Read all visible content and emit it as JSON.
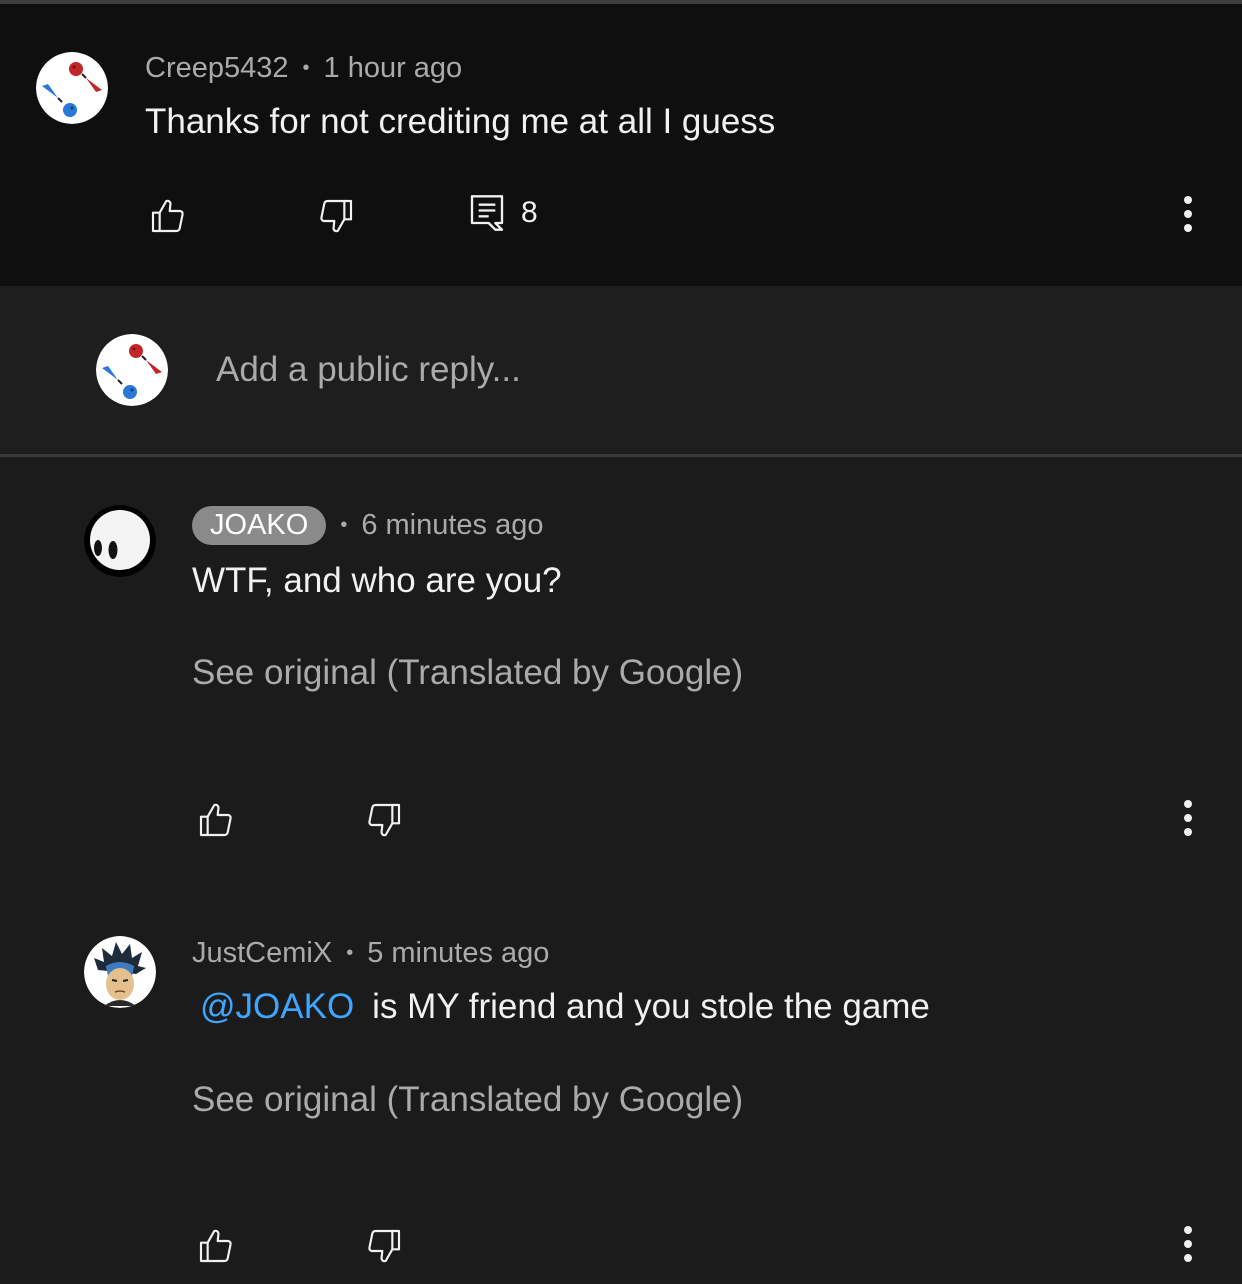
{
  "parent_comment": {
    "author": "Creep5432",
    "separator": "•",
    "time": "1 hour ago",
    "text": "Thanks for not crediting me at all I guess",
    "reply_count": "8",
    "icons": [
      "like-icon",
      "dislike-icon",
      "replies-icon",
      "more-vert-icon"
    ]
  },
  "composer": {
    "placeholder": "Add a public reply..."
  },
  "replies": [
    {
      "author": "JOAKO",
      "author_highlighted": true,
      "separator": "•",
      "time": "6 minutes ago",
      "text": "WTF, and who are you?",
      "see_original": "See original (Translated by Google)"
    },
    {
      "author": "JustCemiX",
      "separator": "•",
      "time": "5 minutes ago",
      "mention": "@JOAKO",
      "text": "is MY friend and you stole the game",
      "see_original": "See original (Translated by Google)"
    }
  ],
  "colors": {
    "background": "#1b1b1b",
    "parent_background": "#0f0f0f",
    "text_primary": "#f1f1f1",
    "text_secondary": "#aaaaaa",
    "mention": "#3ea6ff",
    "chip": "#8a8a8a"
  }
}
